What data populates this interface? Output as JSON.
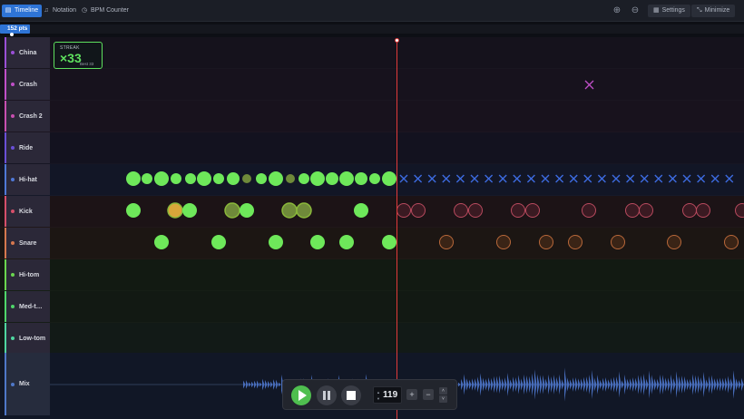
{
  "toolbar": {
    "tabs": [
      {
        "label": "Timeline",
        "icon": "timeline-icon",
        "active": true
      },
      {
        "label": "Notation",
        "icon": "music-note-icon",
        "active": false
      },
      {
        "label": "BPM Counter",
        "icon": "clock-icon",
        "active": false
      }
    ],
    "settings_label": "Settings",
    "minimize_label": "Minimize",
    "zoom_in_icon": "zoom-in-icon",
    "zoom_out_icon": "zoom-out-icon"
  },
  "score": {
    "points_label": "152 pts",
    "progress_fraction": 0.04
  },
  "streak": {
    "title": "STREAK",
    "value": "×33",
    "best": "Best 33"
  },
  "lanes": [
    {
      "name": "China",
      "color": "#9a4fd6"
    },
    {
      "name": "Crash",
      "color": "#c04fc8"
    },
    {
      "name": "Crash 2",
      "color": "#c84fb0"
    },
    {
      "name": "Ride",
      "color": "#6a4fd6"
    },
    {
      "name": "Hi-hat",
      "color": "#4f78d6"
    },
    {
      "name": "Kick",
      "color": "#d64f6a"
    },
    {
      "name": "Snare",
      "color": "#d6784f"
    },
    {
      "name": "Hi-tom",
      "color": "#6ad64f"
    },
    {
      "name": "Med-t…",
      "color": "#4fd66a"
    },
    {
      "name": "Low-tom",
      "color": "#4fd6a0"
    }
  ],
  "mix_lane": {
    "name": "Mix",
    "color": "#4f78c8"
  },
  "transport": {
    "tempo": "119",
    "plus_label": "+",
    "minus_label": "−",
    "up_label": "˄",
    "down_label": "˅",
    "tempo_up": "▲",
    "tempo_down": "▼"
  },
  "colors": {
    "hit": "#6ee85a",
    "late": "#d9a63a",
    "accent": "#2e74d6",
    "playhead": "#e13a3a"
  }
}
